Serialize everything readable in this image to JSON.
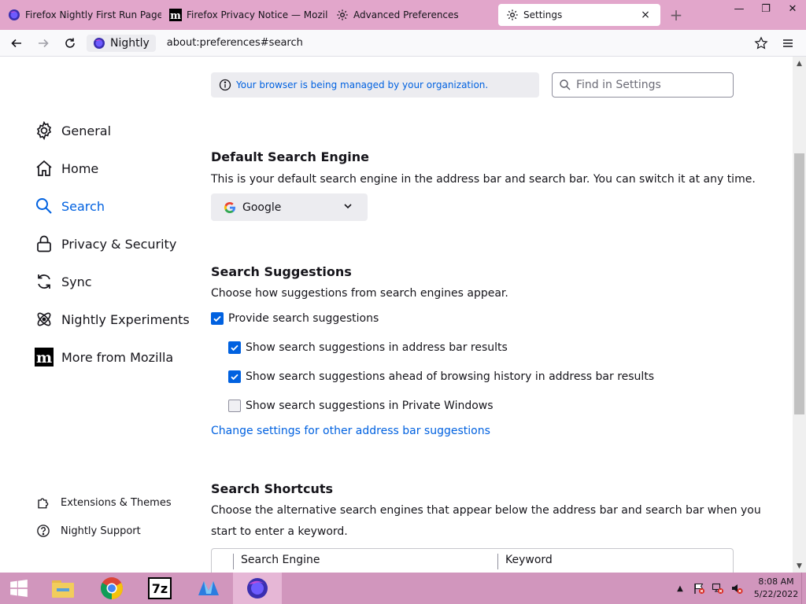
{
  "tabs": [
    {
      "title": "Firefox Nightly First Run Page",
      "icon": "nightly-icon"
    },
    {
      "title": "Firefox Privacy Notice — Mozilla",
      "icon": "mozilla-m-icon"
    },
    {
      "title": "Advanced Preferences",
      "icon": "gear-icon"
    },
    {
      "title": "Settings",
      "icon": "gear-icon",
      "active": true
    }
  ],
  "tab_close": "×",
  "new_tab": "+",
  "window_controls": {
    "minimize": "—",
    "maximize": "❐",
    "close": "✕"
  },
  "navbar": {
    "identity_label": "Nightly",
    "url": "about:preferences#search"
  },
  "policy_notice": "Your browser is being managed by your organization.",
  "find_placeholder": "Find in Settings",
  "sidebar": {
    "items": [
      {
        "label": "General",
        "icon": "gear-icon"
      },
      {
        "label": "Home",
        "icon": "home-icon"
      },
      {
        "label": "Search",
        "icon": "search-icon",
        "selected": true
      },
      {
        "label": "Privacy & Security",
        "icon": "lock-icon"
      },
      {
        "label": "Sync",
        "icon": "sync-icon"
      },
      {
        "label": "Nightly Experiments",
        "icon": "experiments-icon"
      },
      {
        "label": "More from Mozilla",
        "icon": "mozilla-m-icon"
      }
    ],
    "footer": [
      {
        "label": "Extensions & Themes",
        "icon": "puzzle-icon"
      },
      {
        "label": "Nightly Support",
        "icon": "help-icon"
      }
    ]
  },
  "default_search": {
    "heading": "Default Search Engine",
    "description": "This is your default search engine in the address bar and search bar. You can switch it at any time.",
    "selected_engine": "Google"
  },
  "suggestions": {
    "heading": "Search Suggestions",
    "description": "Choose how suggestions from search engines appear.",
    "options": [
      {
        "label": "Provide search suggestions",
        "checked": true
      },
      {
        "label": "Show search suggestions in address bar results",
        "checked": true
      },
      {
        "label": "Show search suggestions ahead of browsing history in address bar results",
        "checked": true
      },
      {
        "label": "Show search suggestions in Private Windows",
        "checked": false
      }
    ],
    "link": "Change settings for other address bar suggestions"
  },
  "shortcuts": {
    "heading": "Search Shortcuts",
    "description_line1": "Choose the alternative search engines that appear below the address bar and search bar when you",
    "description_line2": "start to enter a keyword.",
    "columns": [
      "Search Engine",
      "Keyword"
    ]
  },
  "taskbar": {
    "apps": [
      "windows-start-icon",
      "file-explorer-icon",
      "chrome-icon",
      "7zip-icon",
      "app-icon",
      "nightly-icon"
    ],
    "sevenzip_label": "7z",
    "clock_time": "8:08 AM",
    "clock_date": "5/22/2022"
  },
  "colors": {
    "accent": "#0061e0",
    "tabstrip": "#e2a6cb",
    "taskbar": "#d196bd"
  }
}
